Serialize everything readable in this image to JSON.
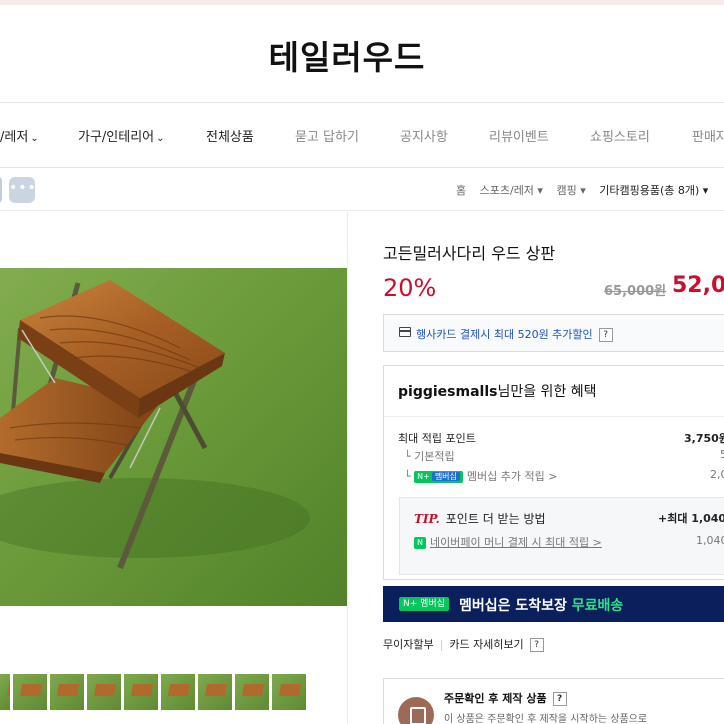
{
  "brand": {
    "title": "테일러우드"
  },
  "nav": {
    "items": [
      {
        "label": "/레저",
        "chevron": "⌄"
      },
      {
        "label": "가구/인테리어",
        "chevron": "⌄"
      },
      {
        "label": "전체상품"
      },
      {
        "label": "묻고 답하기"
      },
      {
        "label": "공지사항"
      },
      {
        "label": "리뷰이벤트"
      },
      {
        "label": "쇼핑스토리"
      },
      {
        "label": "판매자"
      }
    ]
  },
  "breadcrumb": {
    "more": "•••",
    "items": [
      "홈",
      "스포츠/레저 ▾",
      "캠핑 ▾",
      "기타캠핑용품(총 8개) ▾"
    ]
  },
  "product": {
    "name": "고든밀러사다리 우드 상판",
    "discount": "20%",
    "original_price": "65,000원",
    "sale_price": "52,00"
  },
  "card_benefit": {
    "text": "행사카드 결제시 최대 520원 추가할인",
    "help": "?"
  },
  "benefit": {
    "user": "piggiesmalls",
    "title_suffix": "님만을 위한 혜택",
    "max_points_label": "최대 적립 포인트",
    "max_points_value": "3,750원",
    "basic_label": "기본적립",
    "basic_value": "5",
    "membership_badge": "N+",
    "membership_badge_text": "멤버십",
    "membership_label": "멤버십 추가 적립 >",
    "membership_value": "2,0",
    "tip_word": "TIP.",
    "tip_text": "포인트 더 받는 방법",
    "tip_value": "+최대 1,040",
    "naverpay_badge": "N",
    "naverpay_label": "네이버페이 머니 결제 시 최대 적립 >",
    "naverpay_value": "1,040"
  },
  "banner": {
    "badge": "N+ 멤버십",
    "text": "멤버십은 도착보장 ",
    "accent": "무료배송"
  },
  "links": {
    "installment": "무이자할부",
    "card_detail": "카드 자세히보기",
    "help": "?"
  },
  "notice": {
    "title": "주문확인 후 제작 상품",
    "help": "?",
    "desc": "이 상품은 주문확인 후 제작을 시작하는 상품으로"
  }
}
